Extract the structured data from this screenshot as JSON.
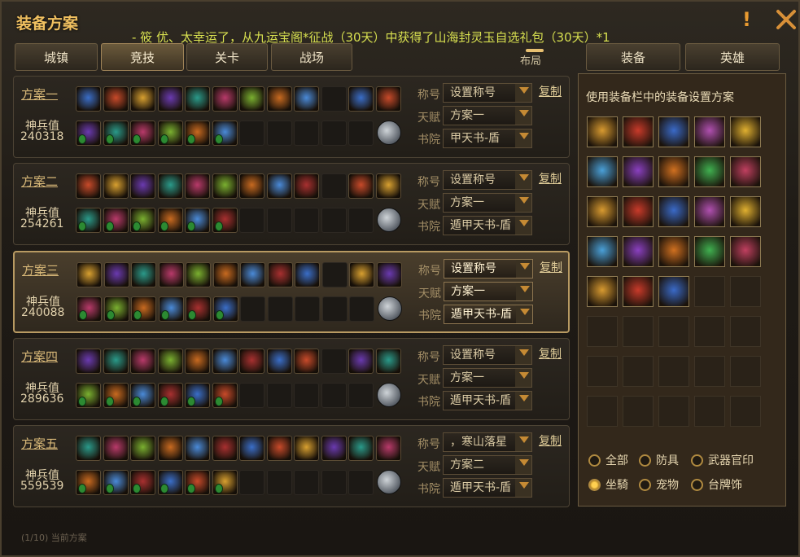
{
  "window": {
    "title": "装备方案",
    "announcement": "-   筱  优、太幸运了，从九运宝阁*征战（30天）中获得了山海封灵玉自选礼包（30天）*1"
  },
  "tabs_left": [
    {
      "label": "城镇",
      "active": false
    },
    {
      "label": "竞技",
      "active": true
    },
    {
      "label": "关卡",
      "active": false
    },
    {
      "label": "战场",
      "active": false
    }
  ],
  "layout_label": "布局",
  "tabs_right": [
    {
      "label": "装备",
      "active": false
    },
    {
      "label": "英雄",
      "active": false
    }
  ],
  "plan_row_labels": {
    "title": "称号",
    "talent": "天赋",
    "academy": "书院"
  },
  "copy_label": "复制",
  "shenbing_label": "神兵值",
  "plans": [
    {
      "name": "方案一",
      "shenbing": "240318",
      "title": "设置称号",
      "talent": "方案一",
      "academy": "甲天书-盾",
      "selected": false
    },
    {
      "name": "方案二",
      "shenbing": "254261",
      "title": "设置称号",
      "talent": "方案一",
      "academy": "遁甲天书-盾",
      "selected": false
    },
    {
      "name": "方案三",
      "shenbing": "240088",
      "title": "设置称号",
      "talent": "方案一",
      "academy": "遁甲天书-盾",
      "selected": true
    },
    {
      "name": "方案四",
      "shenbing": "289636",
      "title": "设置称号",
      "talent": "方案一",
      "academy": "遁甲天书-盾",
      "selected": false
    },
    {
      "name": "方案五",
      "shenbing": "559539",
      "title": "，寒山落星",
      "talent": "方案二",
      "academy": "遁甲天书-盾",
      "selected": false
    }
  ],
  "panel": {
    "title": "使用装备栏中的装备设置方案"
  },
  "filters": [
    {
      "label": "全部",
      "on": false
    },
    {
      "label": "防具",
      "on": false
    },
    {
      "label": "武器官印",
      "on": false
    },
    {
      "label": "坐騎",
      "on": true
    },
    {
      "label": "宠物",
      "on": false
    },
    {
      "label": "台牌饰",
      "on": false
    }
  ],
  "footer": "(1/10) 当前方案"
}
